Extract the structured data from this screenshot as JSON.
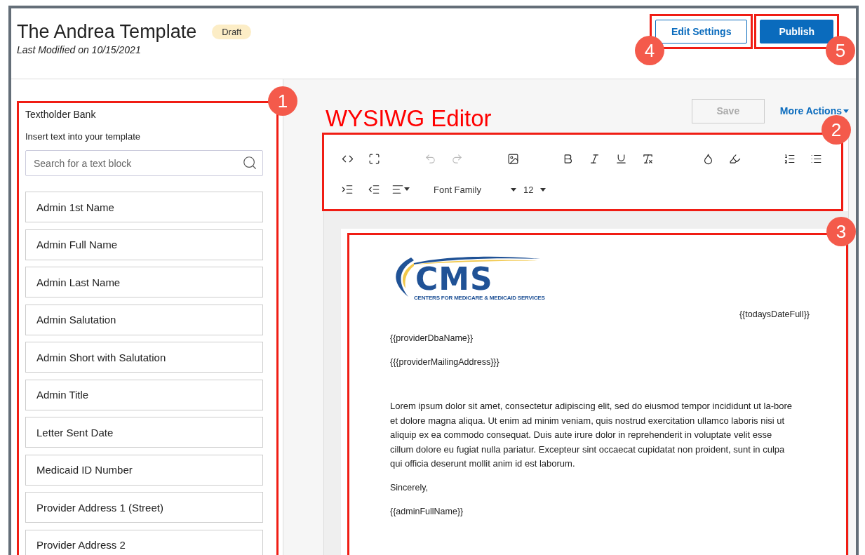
{
  "header": {
    "title": "The Andrea Template",
    "status": "Draft",
    "last_modified": "Last Modified on 10/15/2021",
    "buttons": [
      {
        "label": "Edit Settings",
        "kind": "secondary",
        "annotation": "4"
      },
      {
        "label": "Publish",
        "kind": "primary",
        "annotation": "5"
      }
    ]
  },
  "sidebar": {
    "annotation": "1",
    "title": "Textholder Bank",
    "subtitle": "Insert text into your template",
    "search": {
      "placeholder": "Search for a text block"
    },
    "items": [
      "Admin 1st Name",
      "Admin Full Name",
      "Admin Last Name",
      "Admin Salutation",
      "Admin Short with Salutation",
      "Admin Title",
      "Letter Sent Date",
      "Medicaid ID Number",
      "Provider Address 1 (Street)",
      "Provider Address 2"
    ]
  },
  "editor": {
    "heading": "WYSIWG Editor",
    "save_button": {
      "label": "Save",
      "disabled": true
    },
    "more_actions": "More Actions",
    "toolbar": {
      "annotation": "2",
      "tools": [
        {
          "disabled": false
        },
        {
          "disabled": false
        },
        {
          "disabled": true
        },
        {
          "disabled": true
        },
        {
          "disabled": false
        },
        {
          "disabled": false
        },
        {
          "disabled": false
        },
        {
          "disabled": false
        },
        {
          "disabled": false
        },
        {
          "disabled": false
        },
        {
          "disabled": false
        },
        {
          "disabled": false
        },
        {
          "disabled": false
        }
      ],
      "font_family": "Font Family",
      "font_size": "12"
    },
    "document": {
      "annotation": "3",
      "logo": {
        "mark": "CMS",
        "tagline": "CENTERS FOR MEDICARE & MEDICAID SERVICES"
      },
      "date": "{{todaysDateFull}}",
      "lines": [
        "{{providerDbaName}}",
        "{{{providerMailingAddress}}}"
      ],
      "body": "Lorem ipsum dolor sit amet, consectetur adipiscing elit, sed do eiusmod tempor incididunt ut la-bore et dolore magna aliqua. Ut enim ad minim veniam, quis nostrud exercitation ullamco laboris nisi ut aliquip ex ea commodo consequat. Duis aute irure dolor in reprehenderit in voluptate velit esse cillum dolore eu fugiat nulla pariatur. Excepteur sint occaecat cupidatat non proident, sunt in culpa qui officia deserunt mollit anim id est laborum.",
      "closing": "Sincerely,",
      "signature": "{{adminFullName}}"
    }
  }
}
